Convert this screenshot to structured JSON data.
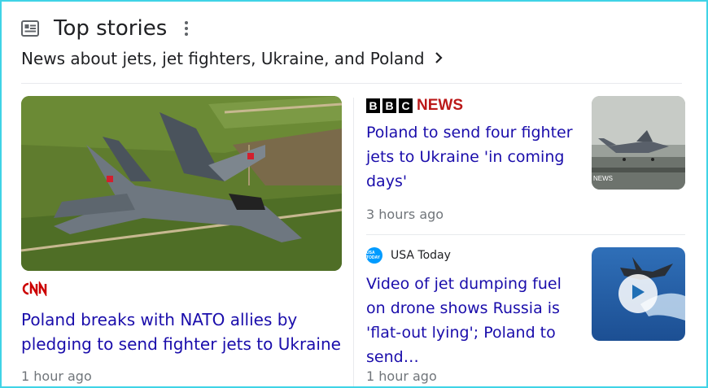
{
  "header": {
    "title": "Top stories",
    "subtitle": "News about jets, jet fighters, Ukraine, and Poland"
  },
  "main_story": {
    "source": "CNN",
    "title": "Poland breaks with NATO allies by pledging to send fighter jets to Ukraine",
    "time": "1 hour ago",
    "image": "fighter-jet-photo"
  },
  "stories": [
    {
      "source_logo": [
        "B",
        "B",
        "C"
      ],
      "source_suffix": "NEWS",
      "title": "Poland to send four fighter jets to Ukraine 'in coming days'",
      "time": "3 hours ago",
      "image": "jet-on-runway-photo",
      "image_watermark": "NEWS"
    },
    {
      "source": "USA Today",
      "source_icon_text": "USA TODAY",
      "title": "Video of jet dumping fuel on drone shows Russia is 'flat-out lying'; Poland to send…",
      "time": "1 hour ago",
      "image": "jet-over-water-video"
    }
  ],
  "colors": {
    "link": "#1a0dab",
    "meta": "#70757a",
    "border_accent": "#3fd3e6",
    "cnn_red": "#cc0000",
    "bbc_red": "#bb1919"
  }
}
